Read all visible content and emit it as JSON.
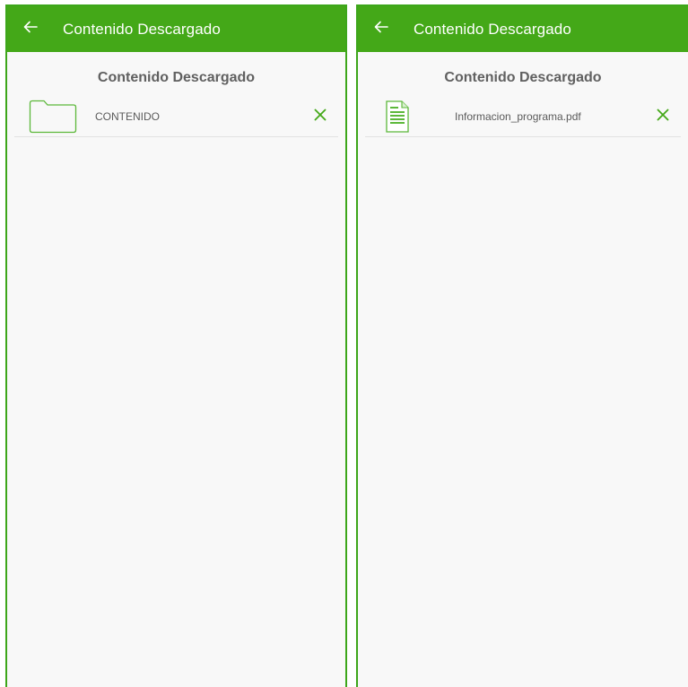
{
  "colors": {
    "accent": "#44a818",
    "border": "#3da61a",
    "icon_green": "#5cb83a",
    "background": "#f8f8f8",
    "text_gray": "#5a5a5a"
  },
  "screens": [
    {
      "appbar": {
        "back_icon": "arrow-left-icon",
        "title": "Contenido Descargado"
      },
      "content_title": "Contenido Descargado",
      "items": [
        {
          "icon": "folder-icon",
          "label": "CONTENIDO",
          "remove_icon": "close-icon"
        }
      ]
    },
    {
      "appbar": {
        "back_icon": "arrow-left-icon",
        "title": "Contenido Descargado"
      },
      "content_title": "Contenido Descargado",
      "items": [
        {
          "icon": "document-icon",
          "label": "Informacion_programa.pdf",
          "remove_icon": "close-icon"
        }
      ]
    }
  ]
}
